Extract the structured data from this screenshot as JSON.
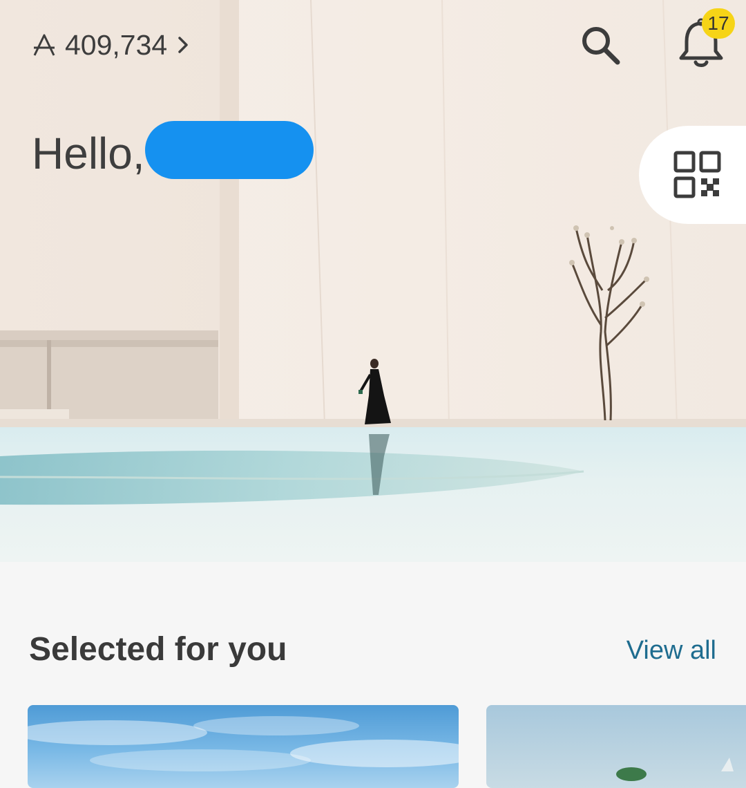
{
  "header": {
    "balance_value": "409,734",
    "points_icon": "points-currency-icon",
    "notification_count": "17",
    "search_icon": "search-icon",
    "bell_icon": "bell-icon"
  },
  "greeting": {
    "text": "Hello,"
  },
  "qr": {
    "icon": "qr-code-icon"
  },
  "selected_section": {
    "title": "Selected for you",
    "view_all_label": "View all"
  },
  "colors": {
    "badge": "#f6d417",
    "link": "#1e6c8f",
    "redaction": "#1591f0",
    "text_primary": "#3a3a3a"
  }
}
